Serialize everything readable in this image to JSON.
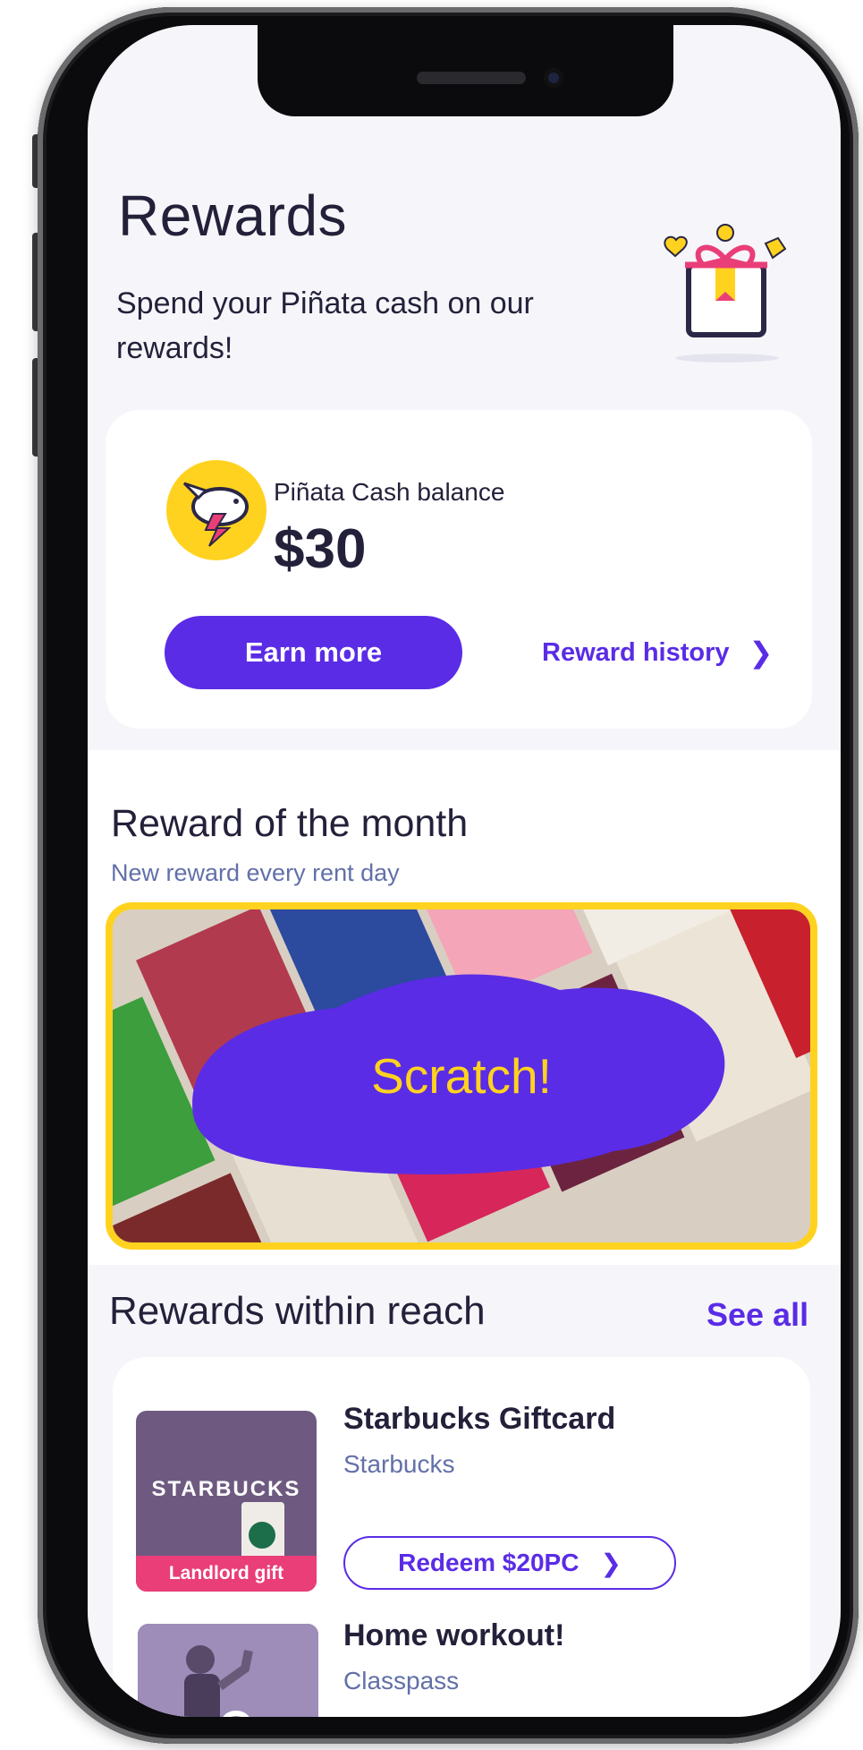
{
  "header": {
    "title": "Rewards",
    "subtitle": "Spend your Piñata cash on our rewards!"
  },
  "balance": {
    "label": "Piñata Cash balance",
    "value": "$30",
    "earn_button": "Earn more",
    "history_link": "Reward history"
  },
  "reward_of_month": {
    "title": "Reward of the month",
    "subtitle": "New reward every rent day",
    "scratch_label": "Scratch!"
  },
  "within_reach": {
    "title": "Rewards within reach",
    "see_all": "See all",
    "items": [
      {
        "title": "Starbucks Giftcard",
        "brand": "Starbucks",
        "thumb_text": "STARBUCKS",
        "badge": "Landlord gift",
        "action": "Redeem $20PC"
      },
      {
        "title": "Home workout!",
        "brand": "Classpass"
      }
    ]
  },
  "colors": {
    "accent": "#5a2ce6",
    "text": "#23213a",
    "muted": "#6270a8",
    "yellow": "#ffd21f",
    "pink": "#e93e78"
  }
}
